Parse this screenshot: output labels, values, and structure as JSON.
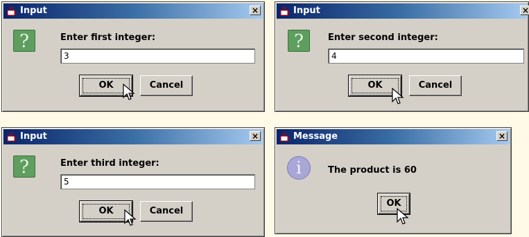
{
  "dialogs": [
    {
      "title": "Input",
      "prompt": "Enter first integer:",
      "value": "3",
      "ok": "OK",
      "cancel": "Cancel"
    },
    {
      "title": "Input",
      "prompt": "Enter second integer:",
      "value": "4",
      "ok": "OK",
      "cancel": "Cancel"
    },
    {
      "title": "Input",
      "prompt": "Enter third integer:",
      "value": "5",
      "ok": "OK",
      "cancel": "Cancel"
    },
    {
      "title": "Message",
      "message": "The product is 60",
      "ok": "OK"
    }
  ],
  "close_glyph": "×",
  "question_glyph": "?",
  "info_glyph": "i",
  "colors": {
    "titlebar_start": "#0a246a",
    "titlebar_end": "#a6caf0",
    "dialog_bg": "#d4d0c8",
    "page_bg": "#fff9e8"
  }
}
